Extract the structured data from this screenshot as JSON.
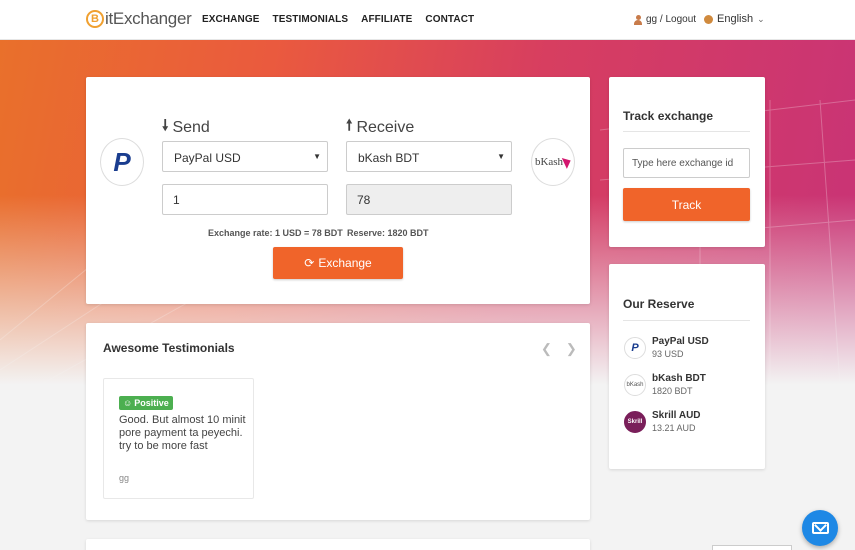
{
  "header": {
    "logo_letter": "B",
    "logo_text": "itExchanger",
    "nav": [
      "EXCHANGE",
      "TESTIMONIALS",
      "AFFILIATE",
      "CONTACT"
    ],
    "user_label": "gg / Logout",
    "language": "English"
  },
  "exchange": {
    "send_label": "Send",
    "receive_label": "Receive",
    "send_method": "PayPal USD",
    "receive_method": "bKash BDT",
    "send_amount": "1",
    "receive_amount": "78",
    "rate_text": "Exchange rate: 1 USD = 78 BDT",
    "reserve_text": "Reserve: 1820 BDT",
    "button_label": "Exchange",
    "send_logo": "P",
    "receive_logo": "bKash"
  },
  "track": {
    "title": "Track exchange",
    "placeholder": "Type here exchange id",
    "button_label": "Track"
  },
  "reserve": {
    "title": "Our Reserve",
    "items": [
      {
        "logo": "P",
        "name": "PayPal USD",
        "amount": "93 USD"
      },
      {
        "logo": "bKash",
        "name": "bKash BDT",
        "amount": "1820 BDT"
      },
      {
        "logo": "Skrill",
        "name": "Skrill AUD",
        "amount": "13.21 AUD"
      }
    ]
  },
  "testimonials": {
    "title": "Awesome Testimonials",
    "items": [
      {
        "badge": "Positive",
        "text": "Good. But almost 10 minit pore payment ta peyechi. try to be more fast",
        "author": "gg"
      }
    ]
  },
  "colors": {
    "accent": "#f0642a",
    "positive": "#4caf50",
    "chat": "#1e88e5"
  }
}
